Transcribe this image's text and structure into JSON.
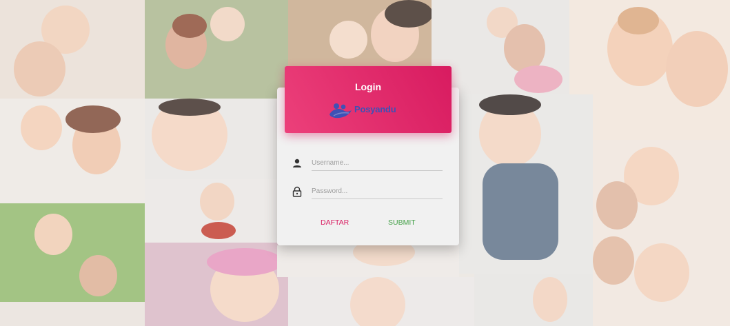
{
  "login": {
    "title": "Login",
    "logo_text": "Posyandu",
    "username_placeholder": "Username...",
    "password_placeholder": "Password...",
    "daftar_label": "DAFTAR",
    "submit_label": "SUBMIT"
  },
  "colors": {
    "header_pink": "#d81b60",
    "daftar_pink": "#d81b60",
    "submit_green": "#43a047",
    "logo_blue": "#3f51b5"
  },
  "icons": {
    "username": "person-icon",
    "password": "lock-icon"
  }
}
